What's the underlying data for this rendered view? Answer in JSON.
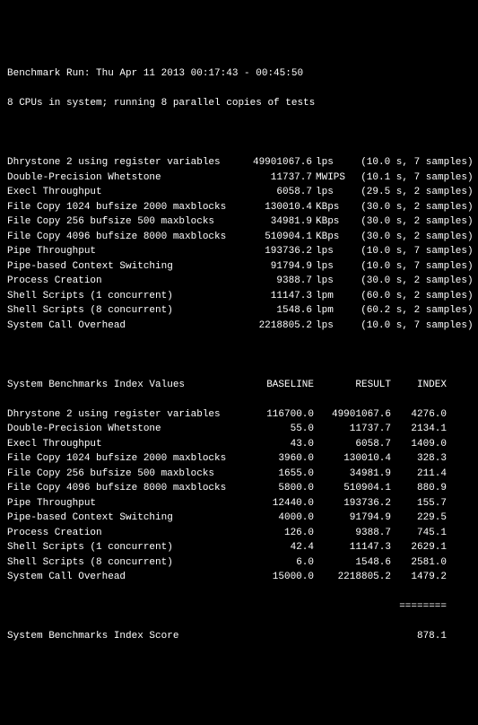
{
  "header": {
    "line1": "Benchmark Run: Thu Apr 11 2013 00:17:43 - 00:45:50",
    "line2": "8 CPUs in system; running 8 parallel copies of tests"
  },
  "results": [
    {
      "name": "Dhrystone 2 using register variables",
      "value": "49901067.6",
      "unit": "lps",
      "time": "(10.0 s,",
      "samples": " 7 samples)"
    },
    {
      "name": "Double-Precision Whetstone",
      "value": "11737.7",
      "unit": "MWIPS",
      "time": "(10.1 s,",
      "samples": " 7 samples)"
    },
    {
      "name": "Execl Throughput",
      "value": "6058.7",
      "unit": "lps",
      "time": "(29.5 s,",
      "samples": " 2 samples)"
    },
    {
      "name": "File Copy 1024 bufsize 2000 maxblocks",
      "value": "130010.4",
      "unit": "KBps",
      "time": "(30.0 s,",
      "samples": " 2 samples)"
    },
    {
      "name": "File Copy 256 bufsize 500 maxblocks",
      "value": "34981.9",
      "unit": "KBps",
      "time": "(30.0 s,",
      "samples": " 2 samples)"
    },
    {
      "name": "File Copy 4096 bufsize 8000 maxblocks",
      "value": "510904.1",
      "unit": "KBps",
      "time": "(30.0 s,",
      "samples": " 2 samples)"
    },
    {
      "name": "Pipe Throughput",
      "value": "193736.2",
      "unit": "lps",
      "time": "(10.0 s,",
      "samples": " 7 samples)"
    },
    {
      "name": "Pipe-based Context Switching",
      "value": "91794.9",
      "unit": "lps",
      "time": "(10.0 s,",
      "samples": " 7 samples)"
    },
    {
      "name": "Process Creation",
      "value": "9388.7",
      "unit": "lps",
      "time": "(30.0 s,",
      "samples": " 2 samples)"
    },
    {
      "name": "Shell Scripts (1 concurrent)",
      "value": "11147.3",
      "unit": "lpm",
      "time": "(60.0 s,",
      "samples": " 2 samples)"
    },
    {
      "name": "Shell Scripts (8 concurrent)",
      "value": "1548.6",
      "unit": "lpm",
      "time": "(60.2 s,",
      "samples": " 2 samples)"
    },
    {
      "name": "System Call Overhead",
      "value": "2218805.2",
      "unit": "lps",
      "time": "(10.0 s,",
      "samples": " 7 samples)"
    }
  ],
  "chart_data": {
    "type": "table",
    "title": "System Benchmarks Index Values",
    "columns": [
      "BASELINE",
      "RESULT",
      "INDEX"
    ],
    "rows": [
      {
        "name": "Dhrystone 2 using register variables",
        "baseline": "116700.0",
        "result": "49901067.6",
        "index": "4276.0"
      },
      {
        "name": "Double-Precision Whetstone",
        "baseline": "55.0",
        "result": "11737.7",
        "index": "2134.1"
      },
      {
        "name": "Execl Throughput",
        "baseline": "43.0",
        "result": "6058.7",
        "index": "1409.0"
      },
      {
        "name": "File Copy 1024 bufsize 2000 maxblocks",
        "baseline": "3960.0",
        "result": "130010.4",
        "index": "328.3"
      },
      {
        "name": "File Copy 256 bufsize 500 maxblocks",
        "baseline": "1655.0",
        "result": "34981.9",
        "index": "211.4"
      },
      {
        "name": "File Copy 4096 bufsize 8000 maxblocks",
        "baseline": "5800.0",
        "result": "510904.1",
        "index": "880.9"
      },
      {
        "name": "Pipe Throughput",
        "baseline": "12440.0",
        "result": "193736.2",
        "index": "155.7"
      },
      {
        "name": "Pipe-based Context Switching",
        "baseline": "4000.0",
        "result": "91794.9",
        "index": "229.5"
      },
      {
        "name": "Process Creation",
        "baseline": "126.0",
        "result": "9388.7",
        "index": "745.1"
      },
      {
        "name": "Shell Scripts (1 concurrent)",
        "baseline": "42.4",
        "result": "11147.3",
        "index": "2629.1"
      },
      {
        "name": "Shell Scripts (8 concurrent)",
        "baseline": "6.0",
        "result": "1548.6",
        "index": "2581.0"
      },
      {
        "name": "System Call Overhead",
        "baseline": "15000.0",
        "result": "2218805.2",
        "index": "1479.2"
      }
    ]
  },
  "score": {
    "label": "System Benchmarks Index Score",
    "rule": "========",
    "value": "878.1"
  }
}
